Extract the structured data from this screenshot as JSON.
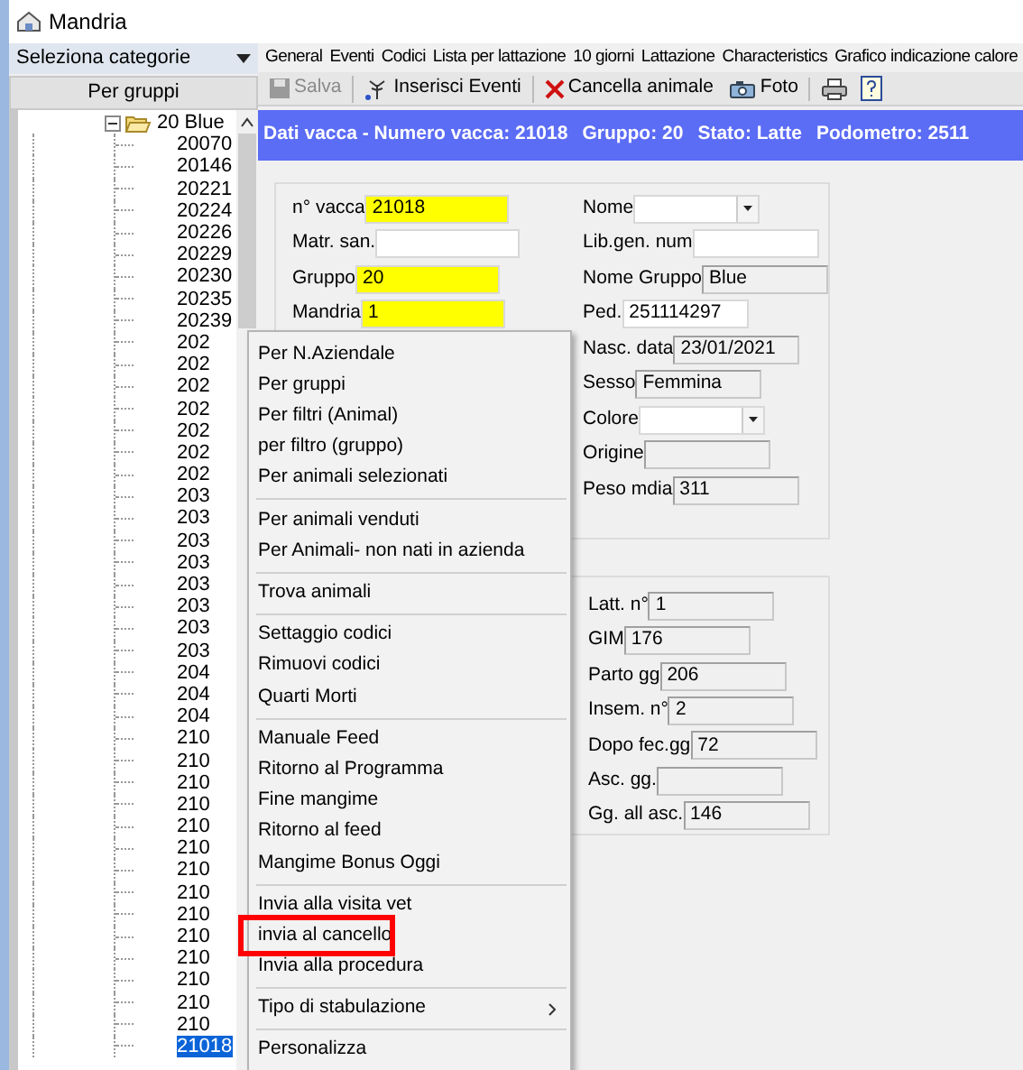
{
  "window": {
    "title": "Mandria"
  },
  "sidebar": {
    "category_select": "Seleziona categorie",
    "view_button": "Per gruppi",
    "tree": [
      {
        "label": "20 Blue",
        "expanded": true,
        "selected": false,
        "children": [
          {
            "label": "20070",
            "selected": false
          },
          {
            "label": "20146",
            "selected": false
          },
          {
            "label": "20221",
            "selected": false
          },
          {
            "label": "20224",
            "selected": false
          },
          {
            "label": "20226",
            "selected": false
          },
          {
            "label": "20229",
            "selected": false
          },
          {
            "label": "20230",
            "selected": false
          },
          {
            "label": "20235",
            "selected": false
          },
          {
            "label": "20239",
            "selected": false
          },
          {
            "label": "202",
            "selected": false
          },
          {
            "label": "202",
            "selected": false
          },
          {
            "label": "202",
            "selected": false
          },
          {
            "label": "202",
            "selected": false
          },
          {
            "label": "202",
            "selected": false
          },
          {
            "label": "202",
            "selected": false
          },
          {
            "label": "202",
            "selected": false
          },
          {
            "label": "203",
            "selected": false
          },
          {
            "label": "203",
            "selected": false
          },
          {
            "label": "203",
            "selected": false
          },
          {
            "label": "203",
            "selected": false
          },
          {
            "label": "203",
            "selected": false
          },
          {
            "label": "203",
            "selected": false
          },
          {
            "label": "203",
            "selected": false
          },
          {
            "label": "203",
            "selected": false
          },
          {
            "label": "204",
            "selected": false
          },
          {
            "label": "204",
            "selected": false
          },
          {
            "label": "204",
            "selected": false
          },
          {
            "label": "210",
            "selected": false
          },
          {
            "label": "210",
            "selected": false
          },
          {
            "label": "210",
            "selected": false
          },
          {
            "label": "210",
            "selected": false
          },
          {
            "label": "210",
            "selected": false
          },
          {
            "label": "210",
            "selected": false
          },
          {
            "label": "210",
            "selected": false
          },
          {
            "label": "210",
            "selected": false
          },
          {
            "label": "210",
            "selected": false
          },
          {
            "label": "210",
            "selected": false
          },
          {
            "label": "210",
            "selected": false
          },
          {
            "label": "210",
            "selected": false
          },
          {
            "label": "210",
            "selected": false
          },
          {
            "label": "210",
            "selected": false
          },
          {
            "label": "21018",
            "selected": true
          }
        ]
      }
    ]
  },
  "menu_bar": [
    "General",
    "Eventi",
    "Codici",
    "Lista per lattazione",
    "10 giorni",
    "Lattazione",
    "Characteristics",
    "Grafico indicazione calore"
  ],
  "toolbar": [
    {
      "kind": "save",
      "label": "Salva",
      "disabled": true
    },
    {
      "kind": "events",
      "label": "Inserisci Eventi",
      "disabled": false
    },
    {
      "kind": "delete",
      "label": "Cancella animale",
      "disabled": false
    },
    {
      "kind": "photo",
      "label": "Foto",
      "disabled": false
    },
    {
      "kind": "print",
      "disabled": false
    },
    {
      "kind": "help",
      "disabled": false
    }
  ],
  "header": [
    "Dati vacca - Numero vacca: 21018",
    "Gruppo: 20",
    "Stato: Latte",
    "Podometro: 2511"
  ],
  "panel_1": {
    "left": [
      {
        "label": "n° vacca",
        "value": "21018",
        "kind": "text",
        "highlighted": true,
        "readonly": false
      },
      {
        "label": "Matr. san.",
        "kind": "text",
        "highlighted": false,
        "readonly": false
      },
      {
        "label": "Gruppo",
        "value": "20",
        "kind": "text",
        "highlighted": true,
        "readonly": false
      },
      {
        "label": "Mandria",
        "value": "1",
        "kind": "text",
        "highlighted": true,
        "readonly": false
      }
    ],
    "right": [
      {
        "label": "Nome",
        "kind": "dropdown",
        "highlighted": false,
        "readonly": false
      },
      {
        "label": "Lib.gen. num",
        "kind": "text",
        "highlighted": false,
        "readonly": false
      },
      {
        "label": "Nome Gruppo",
        "value": "Blue",
        "kind": "text",
        "highlighted": false,
        "readonly": true
      },
      {
        "label": "Ped.",
        "value": "251114297",
        "kind": "text",
        "highlighted": false,
        "readonly": false
      },
      {
        "label": "Nasc. data",
        "value": "23/01/2021",
        "kind": "text",
        "highlighted": false,
        "readonly": true
      },
      {
        "label": "Sesso",
        "value": "Femmina",
        "kind": "text",
        "highlighted": false,
        "readonly": true
      },
      {
        "label": "Colore",
        "kind": "dropdown",
        "highlighted": false,
        "readonly": false
      },
      {
        "label": "Origine",
        "kind": "text",
        "highlighted": false,
        "readonly": true
      },
      {
        "label": "Peso mdia",
        "value": "311",
        "kind": "text",
        "highlighted": false,
        "readonly": true
      }
    ]
  },
  "panel_2": [
    {
      "label": "Latt. n°",
      "value": "1",
      "kind": "text",
      "highlighted": false,
      "readonly": true
    },
    {
      "label": "GIM",
      "value": "176",
      "kind": "text",
      "highlighted": false,
      "readonly": true
    },
    {
      "label": "Parto gg",
      "value": "206",
      "kind": "text",
      "highlighted": false,
      "readonly": true
    },
    {
      "label": "Insem. n°",
      "value": "2",
      "kind": "text",
      "highlighted": false,
      "readonly": true
    },
    {
      "label": "Dopo fec.gg",
      "value": "72",
      "kind": "text",
      "highlighted": false,
      "readonly": true
    },
    {
      "label": "Asc. gg.",
      "kind": "text",
      "highlighted": false,
      "readonly": true
    },
    {
      "label": "Gg. all asc.",
      "value": "146",
      "kind": "text",
      "highlighted": false,
      "readonly": true
    }
  ],
  "context_menu": [
    [
      {
        "label": "Per N.Aziendale",
        "submenu": false,
        "highlighted": false
      },
      {
        "label": "Per gruppi",
        "submenu": false,
        "highlighted": false
      },
      {
        "label": "Per filtri (Animal)",
        "submenu": false,
        "highlighted": false
      },
      {
        "label": "per filtro (gruppo)",
        "submenu": false,
        "highlighted": false
      },
      {
        "label": "Per animali selezionati",
        "submenu": false,
        "highlighted": false
      }
    ],
    [
      {
        "label": "Per animali venduti",
        "submenu": false,
        "highlighted": false
      },
      {
        "label": "Per Animali- non nati in azienda",
        "submenu": false,
        "highlighted": false
      }
    ],
    [
      {
        "label": "Trova animali",
        "submenu": false,
        "highlighted": false
      }
    ],
    [
      {
        "label": "Settaggio codici",
        "submenu": false,
        "highlighted": false
      },
      {
        "label": "Rimuovi codici",
        "submenu": false,
        "highlighted": false
      },
      {
        "label": "Quarti Morti",
        "submenu": false,
        "highlighted": false
      }
    ],
    [
      {
        "label": "Manuale Feed",
        "submenu": false,
        "highlighted": false
      },
      {
        "label": "Ritorno al Programma",
        "submenu": false,
        "highlighted": false
      },
      {
        "label": "Fine mangime",
        "submenu": false,
        "highlighted": false
      },
      {
        "label": "Ritorno al feed",
        "submenu": false,
        "highlighted": false
      },
      {
        "label": "Mangime Bonus Oggi",
        "submenu": false,
        "highlighted": false
      }
    ],
    [
      {
        "label": "Invia alla visita vet",
        "submenu": false,
        "highlighted": false
      },
      {
        "label": "invia al cancello",
        "submenu": false,
        "highlighted": true
      },
      {
        "label": "Invia alla procedura",
        "submenu": false,
        "highlighted": false
      }
    ],
    [
      {
        "label": "Tipo di stabulazione",
        "submenu": true,
        "highlighted": false
      }
    ],
    [
      {
        "label": "Personalizza",
        "submenu": false,
        "highlighted": false
      }
    ]
  ]
}
